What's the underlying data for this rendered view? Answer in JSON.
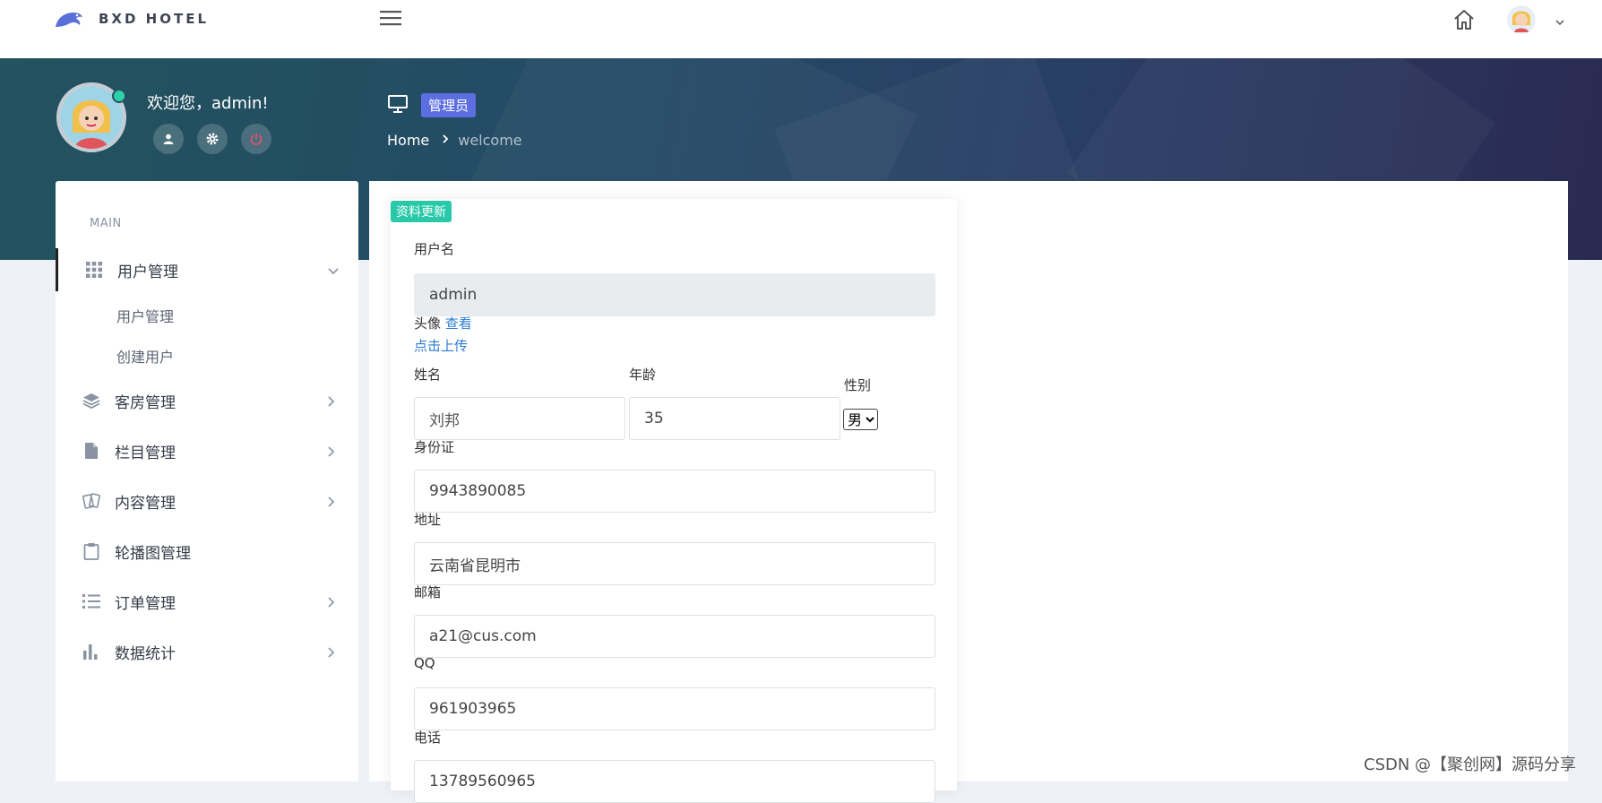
{
  "brand": {
    "name": "BXD HOTEL"
  },
  "header": {
    "home_icon": "home-icon",
    "menu_icon": "hamburger-icon"
  },
  "profile": {
    "welcome": "欢迎您，admin!",
    "buttons": [
      "user-icon",
      "gear-icon",
      "power-icon"
    ]
  },
  "page": {
    "role_badge": "管理员",
    "breadcrumb": {
      "home": "Home",
      "current": "welcome"
    }
  },
  "sidebar": {
    "section": "MAIN",
    "items": [
      {
        "label": "用户管理",
        "icon": "grid-icon",
        "expanded": true,
        "subitems": [
          "用户管理",
          "创建用户"
        ]
      },
      {
        "label": "客房管理",
        "icon": "layers-icon"
      },
      {
        "label": "栏目管理",
        "icon": "file-icon"
      },
      {
        "label": "内容管理",
        "icon": "cards-icon"
      },
      {
        "label": "轮播图管理",
        "icon": "clipboard-icon"
      },
      {
        "label": "订单管理",
        "icon": "list-icon"
      },
      {
        "label": "数据统计",
        "icon": "bar-chart-icon"
      }
    ]
  },
  "form": {
    "badge": "资料更新",
    "username": {
      "label": "用户名",
      "value": "admin"
    },
    "avatar": {
      "label": "头像",
      "view": "查看",
      "upload": "点击上传"
    },
    "name": {
      "label": "姓名",
      "value": "刘邦"
    },
    "age": {
      "label": "年龄",
      "value": "35"
    },
    "gender": {
      "label": "性别",
      "value": "男"
    },
    "id_card": {
      "label": "身份证",
      "value": "9943890085"
    },
    "address": {
      "label": "地址",
      "value": "云南省昆明市"
    },
    "email": {
      "label": "邮箱",
      "value": "a21@cus.com"
    },
    "qq": {
      "label": "QQ",
      "value": "961903965"
    },
    "phone": {
      "label": "电话",
      "value": "13789560965"
    }
  },
  "watermark": "CSDN @【聚创网】源码分享",
  "colors": {
    "accent": "#5d6fe0",
    "badge": "#27c9a8",
    "link": "#2b7cd3",
    "online": "#2bd4a8"
  }
}
